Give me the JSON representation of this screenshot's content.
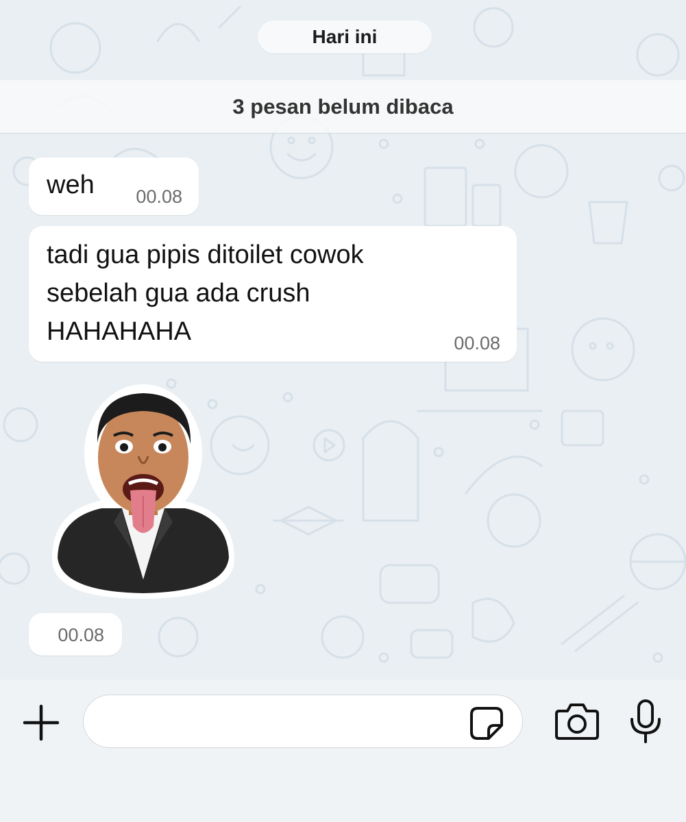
{
  "date_divider": "Hari ini",
  "unread_banner": "3 pesan belum dibaca",
  "messages": [
    {
      "text": "weh",
      "time": "00.08"
    },
    {
      "lines": [
        "tadi gua pipis ditoilet cowok",
        "sebelah gua ada crush",
        "HAHAHAHA"
      ],
      "time": "00.08"
    },
    {
      "type": "sticker",
      "time": "00.08"
    }
  ],
  "composer": {
    "input_value": "",
    "icons": {
      "attach": "plus-icon",
      "sticker": "sticker-icon",
      "camera": "camera-icon",
      "mic": "microphone-icon"
    }
  },
  "colors": {
    "chat_background": "#e9eff3",
    "bubble": "#ffffff",
    "composer_background": "#f0f3f6"
  }
}
